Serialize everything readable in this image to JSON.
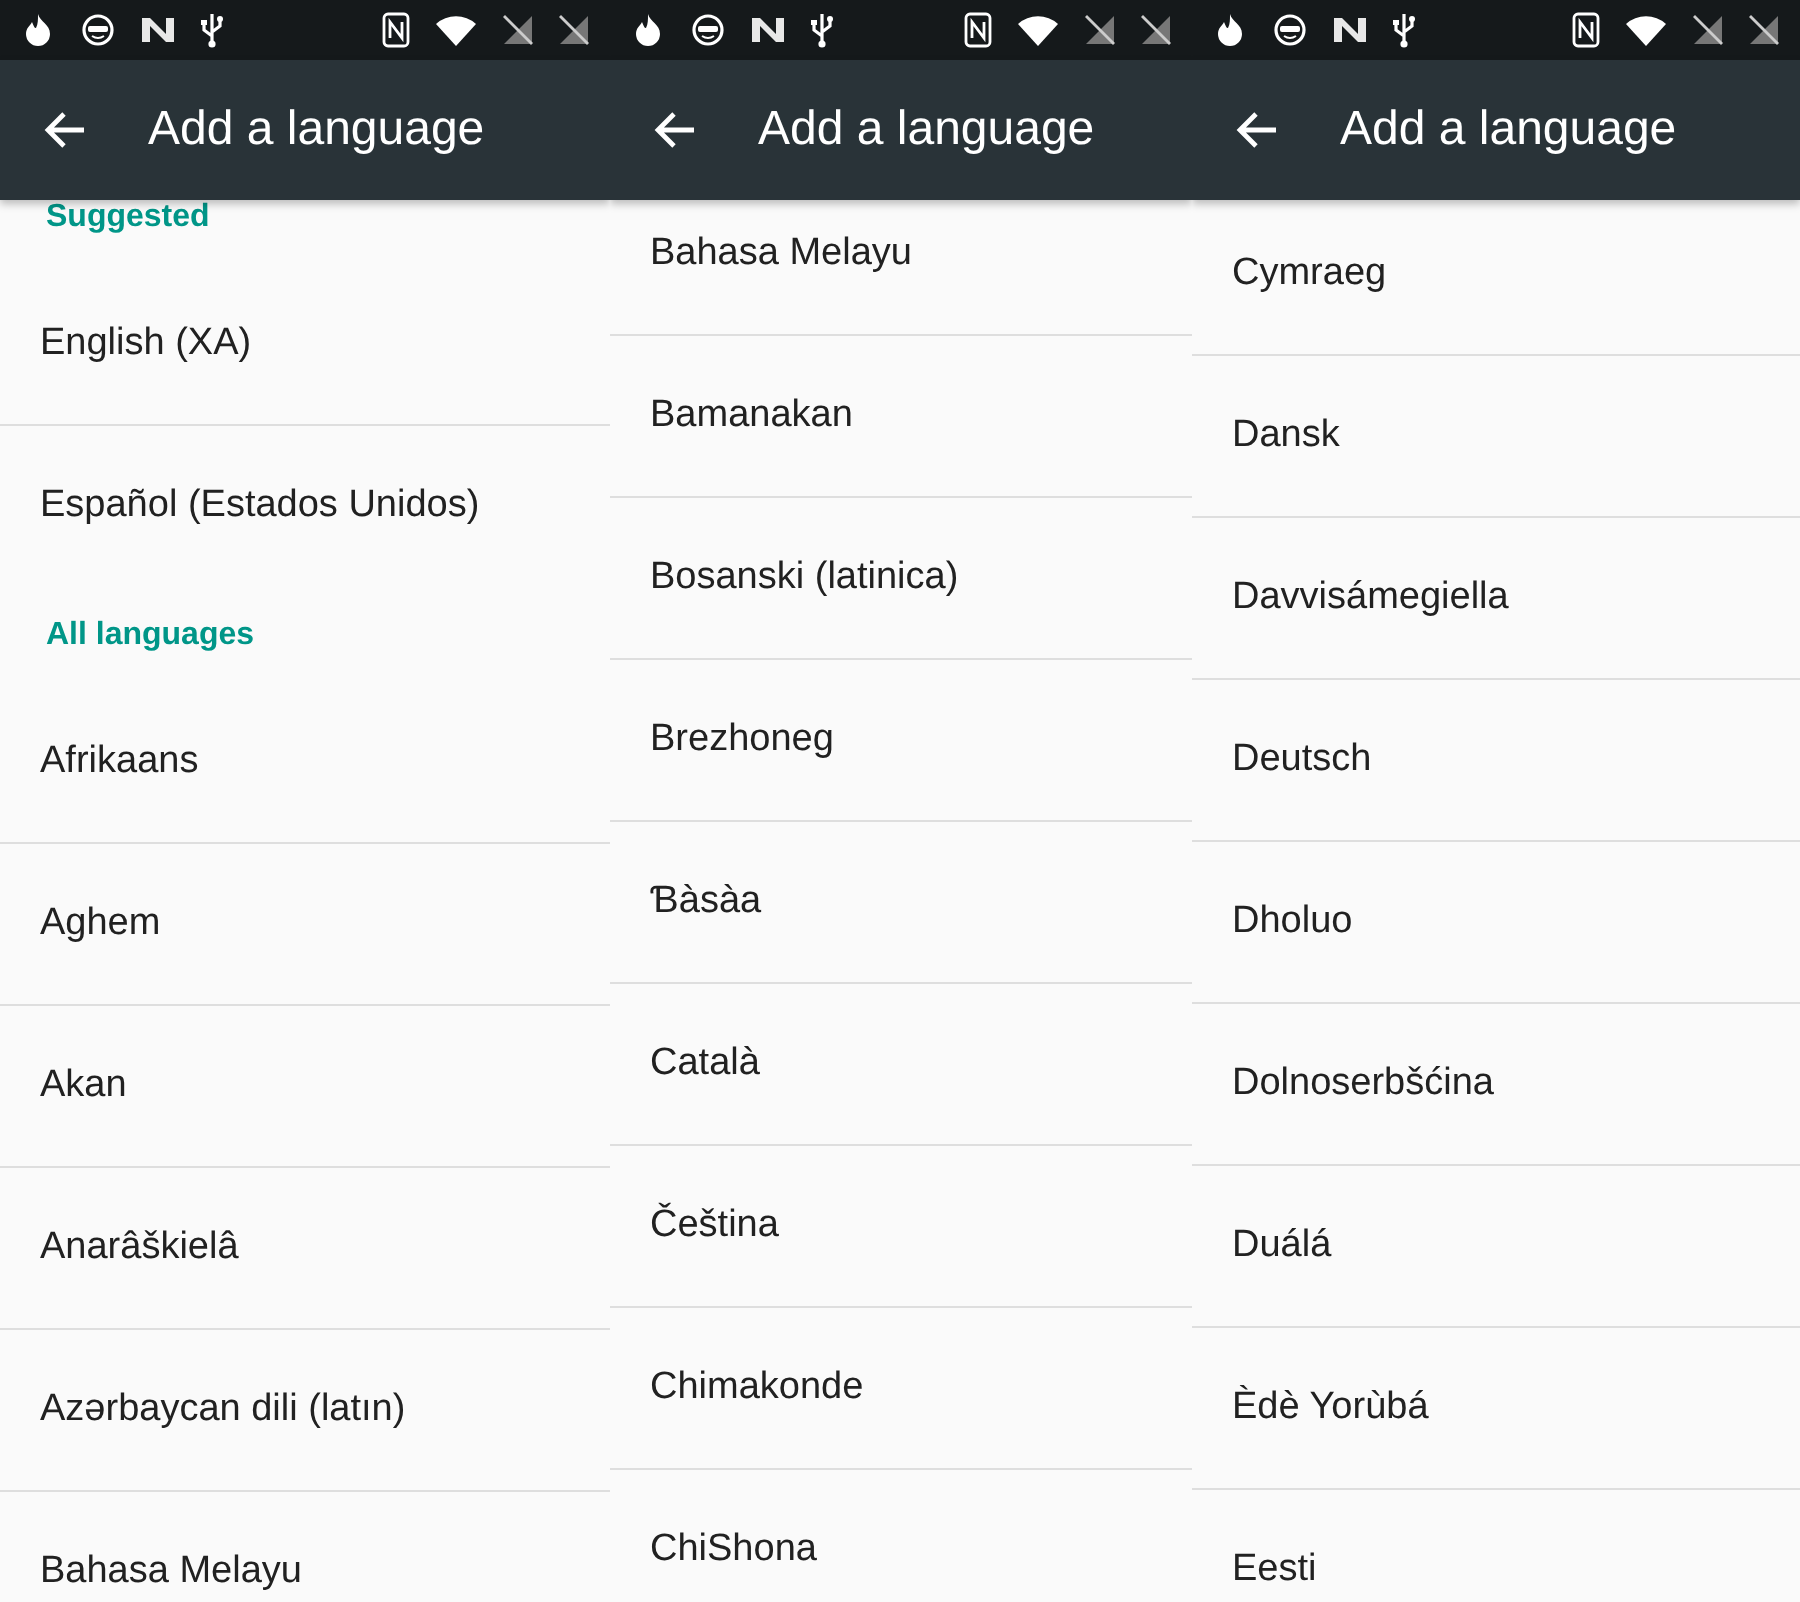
{
  "panels": [
    {
      "title": "Add a language",
      "items": [
        {
          "kind": "subheader",
          "label": "Suggested"
        },
        {
          "kind": "language",
          "label": "English (XA)"
        },
        {
          "kind": "language",
          "label": "Español (Estados Unidos)"
        },
        {
          "kind": "subheader",
          "label": "All languages"
        },
        {
          "kind": "language",
          "label": "Afrikaans"
        },
        {
          "kind": "language",
          "label": "Aghem"
        },
        {
          "kind": "language",
          "label": "Akan"
        },
        {
          "kind": "language",
          "label": "Anarâškielâ"
        },
        {
          "kind": "language",
          "label": "Azərbaycan dili (latın)"
        },
        {
          "kind": "language",
          "label": "Bahasa Melayu"
        }
      ]
    },
    {
      "title": "Add a language",
      "items": [
        {
          "kind": "language",
          "label": "Bahasa Melayu"
        },
        {
          "kind": "language",
          "label": "Bamanakan"
        },
        {
          "kind": "language",
          "label": "Bosanski (latinica)"
        },
        {
          "kind": "language",
          "label": "Brezhoneg"
        },
        {
          "kind": "language",
          "label": "Ɓàsàa"
        },
        {
          "kind": "language",
          "label": "Català"
        },
        {
          "kind": "language",
          "label": "Čeština"
        },
        {
          "kind": "language",
          "label": "Chimakonde"
        },
        {
          "kind": "language",
          "label": "ChiShona"
        }
      ]
    },
    {
      "title": "Add a language",
      "items": [
        {
          "kind": "language",
          "label": "Cymraeg"
        },
        {
          "kind": "language",
          "label": "Dansk"
        },
        {
          "kind": "language",
          "label": "Davvisámegiella"
        },
        {
          "kind": "language",
          "label": "Deutsch"
        },
        {
          "kind": "language",
          "label": "Dholuo"
        },
        {
          "kind": "language",
          "label": "Dolnoserbšćina"
        },
        {
          "kind": "language",
          "label": "Duálá"
        },
        {
          "kind": "language",
          "label": "Èdè Yorùbá"
        },
        {
          "kind": "language",
          "label": "Eesti"
        }
      ]
    }
  ]
}
